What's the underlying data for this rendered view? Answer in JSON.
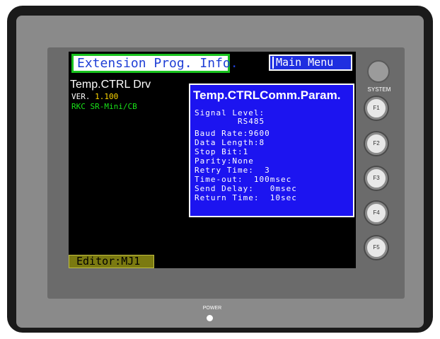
{
  "screen": {
    "title": "Extension Prog. Info.",
    "main_menu": "Main Menu",
    "driver_name": "Temp.CTRL Drv",
    "version_label": "VER.",
    "version_value": "1.100",
    "model": "RKC SR-Mini/CB",
    "editor": "Editor:MJ1"
  },
  "params": {
    "title": "Temp.CTRLComm.Param.",
    "rows": [
      "Signal Level:",
      "        RS485",
      "Baud Rate:9600",
      "Data Length:8",
      "Stop Bit:1",
      "Parity:None",
      "Retry Time:  3",
      "Time-out:  100msec",
      "Send Delay:   0msec",
      "Return Time:  10sec"
    ]
  },
  "hardware": {
    "system_label": "SYSTEM",
    "f_keys": [
      "F1",
      "F2",
      "F3",
      "F4",
      "F5"
    ],
    "power_label": "POWER"
  },
  "colors": {
    "title_text": "#1f3fd6",
    "title_border": "#19c21e",
    "param_bg": "#1c14f0",
    "version": "#ffd800",
    "model": "#19e019",
    "editor_bg": "#7b7a10"
  }
}
